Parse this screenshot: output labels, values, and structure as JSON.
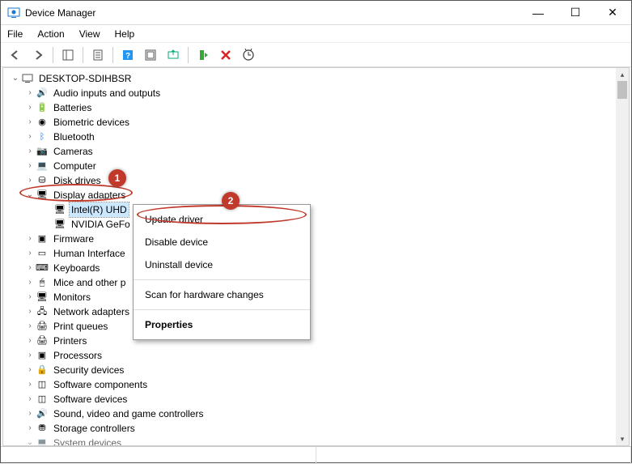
{
  "window": {
    "title": "Device Manager",
    "controls": {
      "min": "—",
      "max": "☐",
      "close": "✕"
    }
  },
  "menu": {
    "file": "File",
    "action": "Action",
    "view": "View",
    "help": "Help"
  },
  "tree": {
    "root": "DESKTOP-SDIHBSR",
    "items": [
      "Audio inputs and outputs",
      "Batteries",
      "Biometric devices",
      "Bluetooth",
      "Cameras",
      "Computer",
      "Disk drives",
      "Display adapters",
      "Firmware",
      "Human Interface",
      "Keyboards",
      "Mice and other p",
      "Monitors",
      "Network adapters",
      "Print queues",
      "Printers",
      "Processors",
      "Security devices",
      "Software components",
      "Software devices",
      "Sound, video and game controllers",
      "Storage controllers",
      "System devices"
    ],
    "display_children": {
      "child1": "Intel(R) UHD",
      "child2": "NVIDIA GeFo"
    }
  },
  "context_menu": {
    "update": "Update driver",
    "disable": "Disable device",
    "uninstall": "Uninstall device",
    "scan": "Scan for hardware changes",
    "properties": "Properties"
  },
  "badges": {
    "b1": "1",
    "b2": "2"
  }
}
